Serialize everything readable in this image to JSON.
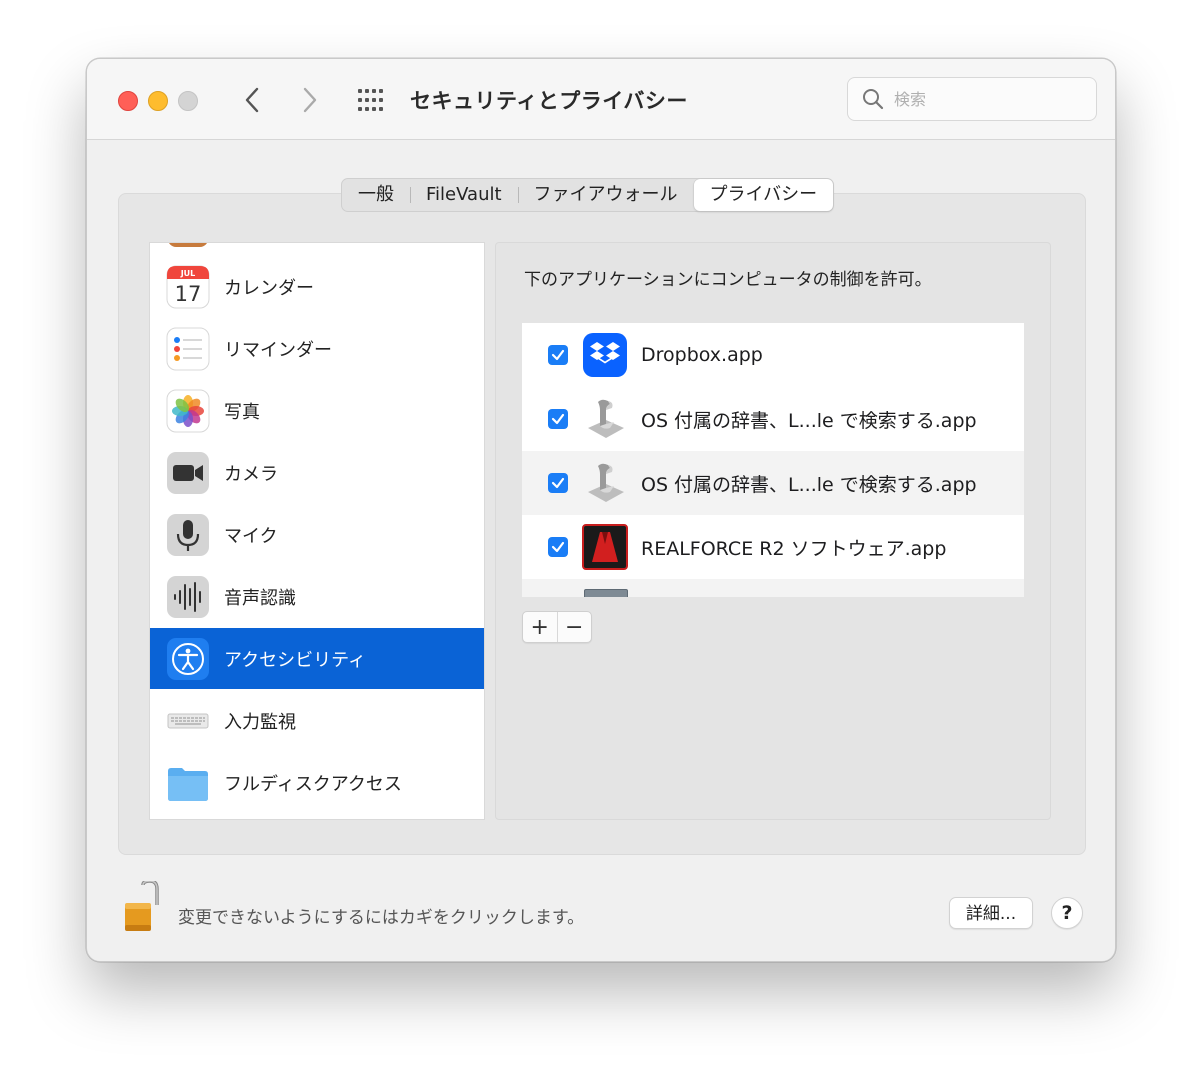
{
  "window": {
    "title": "セキュリティとプライバシー",
    "search_placeholder": "検索"
  },
  "tabs": [
    {
      "label": "一般",
      "active": false
    },
    {
      "label": "FileVault",
      "active": false
    },
    {
      "label": "ファイアウォール",
      "active": false
    },
    {
      "label": "プライバシー",
      "active": true
    }
  ],
  "sidebar": {
    "calendar_month": "JUL",
    "calendar_day": "17",
    "items": [
      {
        "label": "カレンダー",
        "icon": "calendar-icon"
      },
      {
        "label": "リマインダー",
        "icon": "reminders-icon"
      },
      {
        "label": "写真",
        "icon": "photos-icon"
      },
      {
        "label": "カメラ",
        "icon": "camera-icon"
      },
      {
        "label": "マイク",
        "icon": "microphone-icon"
      },
      {
        "label": "音声認識",
        "icon": "speech-recognition-icon"
      },
      {
        "label": "アクセシビリティ",
        "icon": "accessibility-icon",
        "selected": true
      },
      {
        "label": "入力監視",
        "icon": "keyboard-icon"
      },
      {
        "label": "フルディスクアクセス",
        "icon": "folder-icon"
      }
    ]
  },
  "pane": {
    "description": "下のアプリケーションにコンピュータの制御を許可。",
    "apps": [
      {
        "name": "Dropbox.app",
        "checked": true,
        "icon": "dropbox-icon"
      },
      {
        "name": "OS 付属の辞書、L...le で検索する.app",
        "checked": true,
        "icon": "automator-script-icon"
      },
      {
        "name": "OS 付属の辞書、L...le で検索する.app",
        "checked": true,
        "icon": "automator-script-icon"
      },
      {
        "name": "REALFORCE R2 ソフトウェア.app",
        "checked": true,
        "icon": "realforce-icon"
      }
    ],
    "add_label": "+",
    "remove_label": "−"
  },
  "footer": {
    "lock_text": "変更できないようにするにはカギをクリックします。",
    "details_label": "詳細...",
    "help_label": "?"
  },
  "colors": {
    "selection": "#0a63d6",
    "checkbox": "#1a7df6",
    "close": "#ff5f57",
    "minimize": "#febc2e"
  }
}
